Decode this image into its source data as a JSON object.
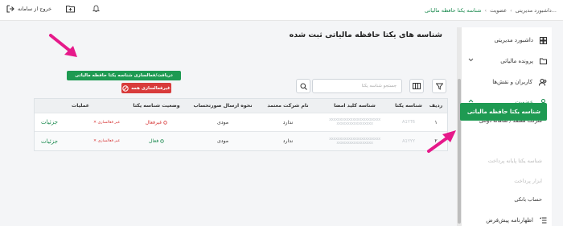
{
  "topbar": {
    "breadcrumbs": [
      "...داشبورد مدیریتی",
      "عضویت",
      "شناسه یکتا حافظه مالیاتی"
    ],
    "logout_label": "خروج از سامانه",
    "icons": [
      "logout-icon",
      "folder-icon",
      "bell-icon"
    ]
  },
  "sidebar": {
    "items": [
      {
        "label": "داشبورد مدیریتی",
        "icon": "dashboard-icon"
      },
      {
        "label": "پرونده مالیاتی",
        "icon": "folder-icon"
      },
      {
        "label": "کاربران و نقش‌ها",
        "icon": "users-icon"
      },
      {
        "label": "عضویت",
        "icon": "user-icon"
      }
    ],
    "subitems": [
      "شرکت معتمد / سامانه دولتی",
      "شناسه یکتا حافظه مالیاتی",
      "شناسه یکتا پایانه پرداخت",
      "ابزار پرداخت",
      "حساب بانکی"
    ],
    "last_item": {
      "label": "اظهارنامه پیش‌فرض",
      "icon": "list-check-icon"
    }
  },
  "main": {
    "title": "شناسه های یکتا حافظه مالیاتی ثبت شده",
    "get_button": "دریافت/فعالسازی شناسه یکتا حافظه مالیاتی",
    "deactivate_all_button": "غیرفعالسازی همه",
    "search_placeholder": "جستجو شناسه یکتا"
  },
  "table": {
    "headers": [
      "ردیف",
      "شناسه یکتا",
      "شناسه کلید امضا",
      "نام شرکت معتمد",
      "نحوه ارسال صورتحساب",
      "وضعیت شناسه یکتا",
      "عملیات"
    ],
    "rows": [
      {
        "index": "۱",
        "id": "A1YT6",
        "key": "xxxxxxxxxxxxxxxxxxxxxxxx",
        "key2": "xxxxxxxxxxxxxxxxx",
        "company": "ندارد",
        "method": "مودی",
        "status": "غیرفعال",
        "status_type": "inactive",
        "deactivate": "غیر فعالسازی",
        "details": "جزئیات"
      },
      {
        "index": "۲",
        "id": "A1YYY",
        "key": "xxxxxxxxxxxxxxxxxxxxxxxx",
        "key2": "xxxxxxxxxxxxxxxxx",
        "company": "ندارد",
        "method": "مودی",
        "status": "فعال",
        "status_type": "active",
        "deactivate": "غیر فعالسازی",
        "details": "جزئیات"
      }
    ]
  },
  "colors": {
    "brand_green": "#1e9a52",
    "danger_red": "#d83b3b",
    "arrow_magenta": "#e6198a"
  }
}
